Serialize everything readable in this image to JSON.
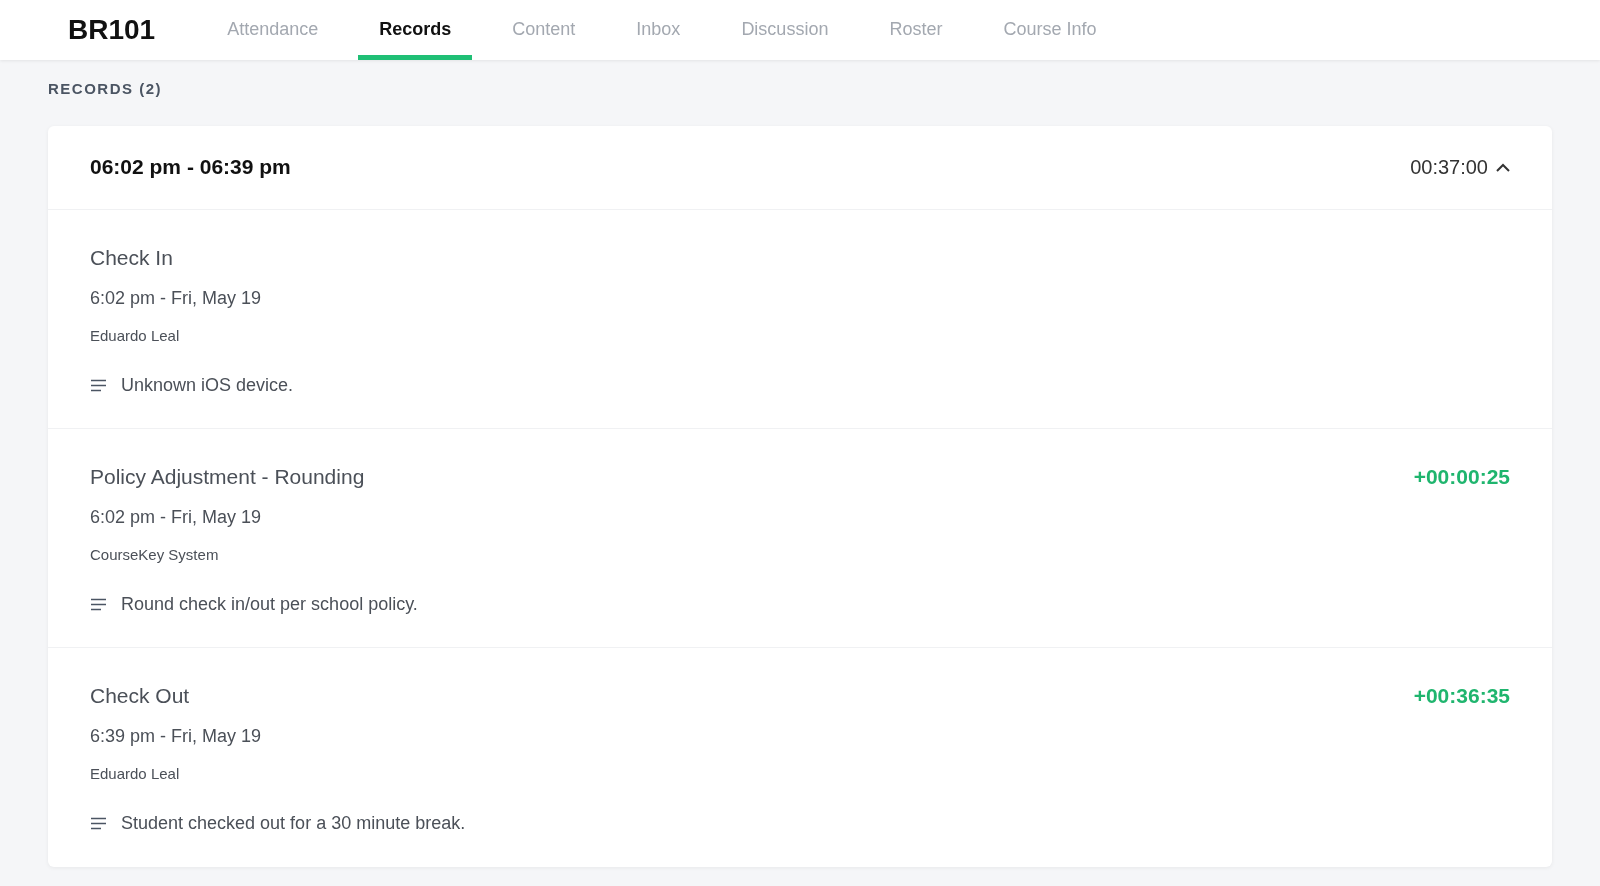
{
  "course": "BR101",
  "tabs": [
    {
      "label": "Attendance",
      "selected": false
    },
    {
      "label": "Records",
      "selected": true
    },
    {
      "label": "Content",
      "selected": false
    },
    {
      "label": "Inbox",
      "selected": false
    },
    {
      "label": "Discussion",
      "selected": false
    },
    {
      "label": "Roster",
      "selected": false
    },
    {
      "label": "Course Info",
      "selected": false
    }
  ],
  "section_title": "RECORDS (2)",
  "record": {
    "time_range": "06:02 pm - 06:39 pm",
    "duration": "00:37:00",
    "expanded": true,
    "events": [
      {
        "title": "Check In",
        "time": "6:02 pm - Fri, May 19",
        "actor": "Eduardo Leal",
        "note": "Unknown iOS device."
      },
      {
        "title": "Policy Adjustment - Rounding",
        "time": "6:02 pm - Fri, May 19",
        "actor": "CourseKey System",
        "note": "Round check in/out per school policy.",
        "delta": "+00:00:25"
      },
      {
        "title": "Check Out",
        "time": "6:39 pm - Fri, May 19",
        "actor": "Eduardo Leal",
        "note": "Student checked out for a 30 minute break.",
        "delta": "+00:36:35"
      }
    ]
  }
}
